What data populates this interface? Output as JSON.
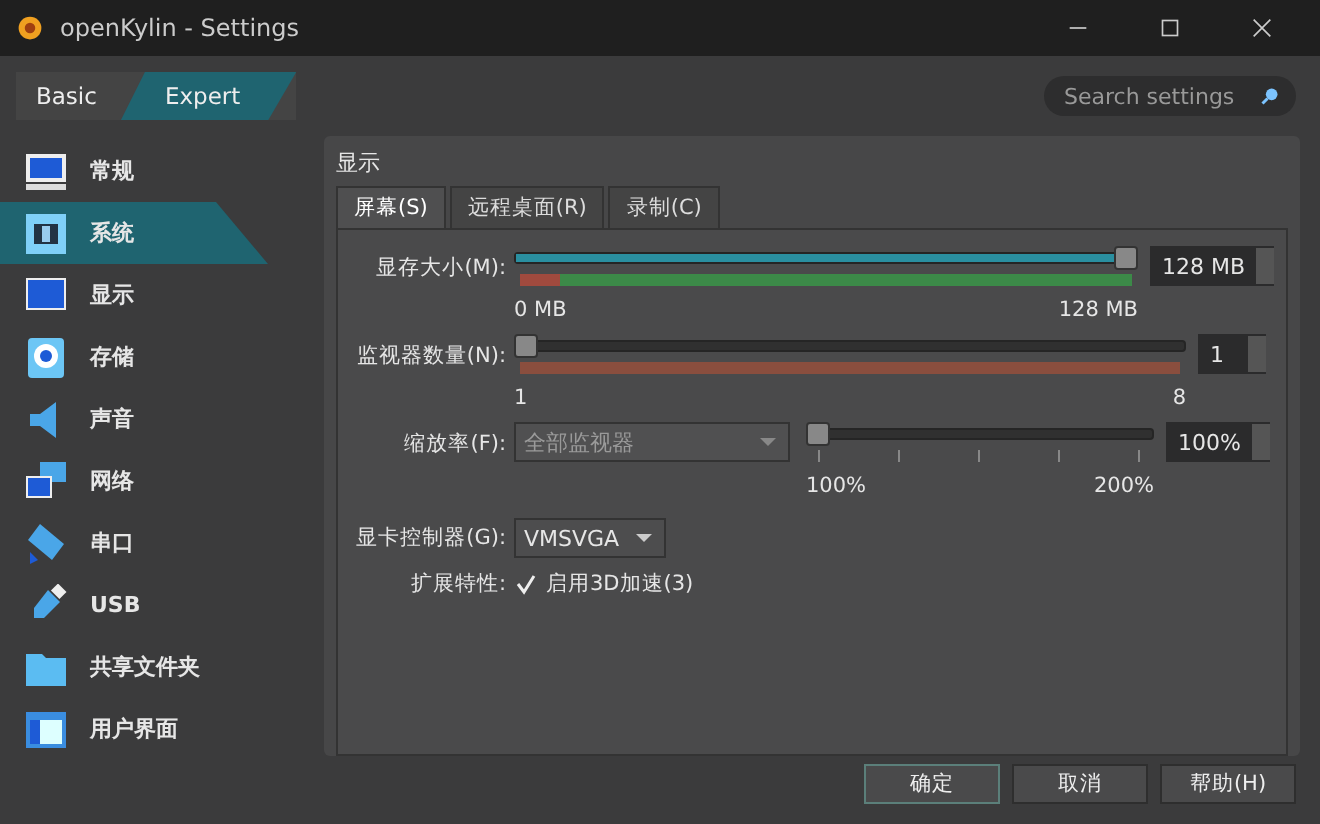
{
  "window": {
    "title": "openKylin - Settings"
  },
  "modes": [
    {
      "label": "Basic",
      "selected": false
    },
    {
      "label": "Expert",
      "selected": true
    }
  ],
  "search": {
    "placeholder": "Search settings"
  },
  "sidebar": {
    "items": [
      {
        "label": "常规",
        "selected": false
      },
      {
        "label": "系统",
        "selected": true
      },
      {
        "label": "显示",
        "selected": false
      },
      {
        "label": "存储",
        "selected": false
      },
      {
        "label": "声音",
        "selected": false
      },
      {
        "label": "网络",
        "selected": false
      },
      {
        "label": "串口",
        "selected": false
      },
      {
        "label": "USB",
        "selected": false
      },
      {
        "label": "共享文件夹",
        "selected": false
      },
      {
        "label": "用户界面",
        "selected": false
      }
    ]
  },
  "section": {
    "title": "显示"
  },
  "tabs": [
    {
      "label": "屏幕(S)",
      "selected": true
    },
    {
      "label": "远程桌面(R)",
      "selected": false
    },
    {
      "label": "录制(C)",
      "selected": false
    }
  ],
  "screen": {
    "memory": {
      "label": "显存大小(M):",
      "level": 1,
      "value": "128 MB",
      "min": "0 MB",
      "max": "128 MB"
    },
    "monitors": {
      "label": "监视器数量(N):",
      "level": 0,
      "value": "1",
      "min": "1",
      "max": "8"
    },
    "scale": {
      "label": "缩放率(F):",
      "combo": {
        "value": "全部监视器",
        "disabled": true
      },
      "level": 0,
      "value": "100%",
      "min": "100%",
      "max": "200%"
    },
    "controller": {
      "label": "显卡控制器(G):",
      "value": "VMSVGA"
    },
    "features": {
      "label": "扩展特性:",
      "checkbox": {
        "label": "启用3D加速(3)",
        "checked": true
      }
    }
  },
  "buttons": [
    "确定",
    "取消",
    "帮助(H)"
  ]
}
